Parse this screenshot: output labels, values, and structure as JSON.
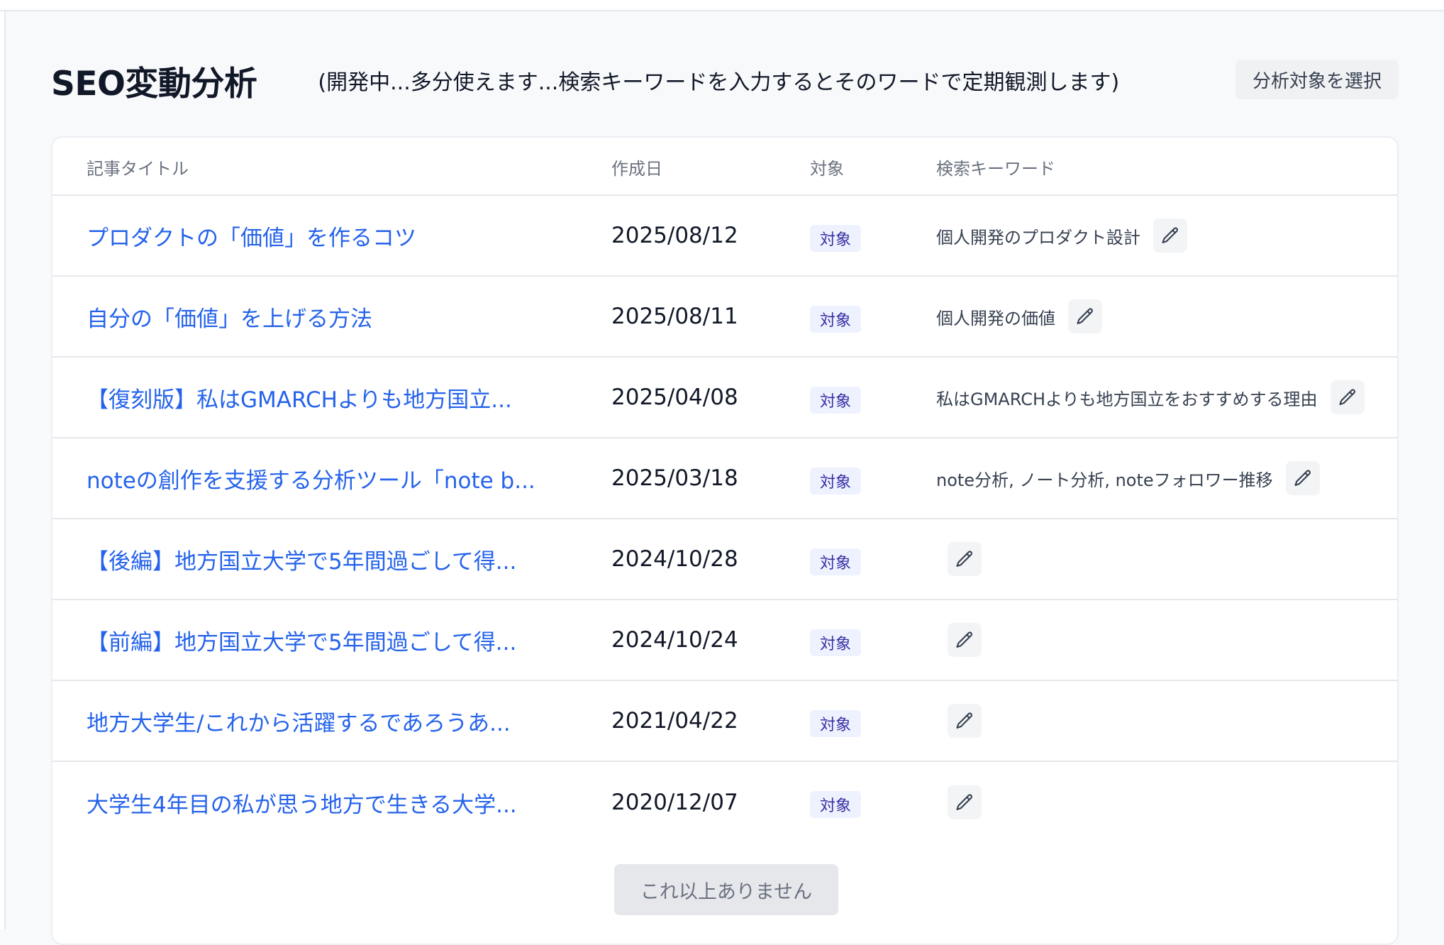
{
  "header": {
    "title": "SEO変動分析",
    "subtitle": "(開発中...多分使えます...検索キーワードを入力するとそのワードで定期観測します)",
    "select_button": "分析対象を選択"
  },
  "table": {
    "columns": [
      "記事タイトル",
      "作成日",
      "対象",
      "検索キーワード"
    ],
    "rows": [
      {
        "title": "プロダクトの「価値」を作るコツ",
        "date": "2025/08/12",
        "badge": "対象",
        "keywords": "個人開発のプロダクト設計"
      },
      {
        "title": "自分の「価値」を上げる方法",
        "date": "2025/08/11",
        "badge": "対象",
        "keywords": "個人開発の価値"
      },
      {
        "title": "【復刻版】私はGMARCHよりも地方国立...",
        "date": "2025/04/08",
        "badge": "対象",
        "keywords": "私はGMARCHよりも地方国立をおすすめする理由"
      },
      {
        "title": "noteの創作を支援する分析ツール「note b...",
        "date": "2025/03/18",
        "badge": "対象",
        "keywords": "note分析, ノート分析, noteフォロワー推移"
      },
      {
        "title": "【後編】地方国立大学で5年間過ごして得...",
        "date": "2024/10/28",
        "badge": "対象",
        "keywords": ""
      },
      {
        "title": "【前編】地方国立大学で5年間過ごして得...",
        "date": "2024/10/24",
        "badge": "対象",
        "keywords": ""
      },
      {
        "title": "地方大学生/これから活躍するであろうあ...",
        "date": "2021/04/22",
        "badge": "対象",
        "keywords": ""
      },
      {
        "title": "大学生4年目の私が思う地方で生きる大学...",
        "date": "2020/12/07",
        "badge": "対象",
        "keywords": ""
      }
    ]
  },
  "footer": {
    "more_button": "これ以上ありません"
  },
  "colors": {
    "link": "#2563eb",
    "badge_bg": "#eef2ff",
    "badge_text": "#3730a3",
    "background": "#f8f9fb"
  },
  "icons": {
    "edit": "pencil-icon"
  }
}
